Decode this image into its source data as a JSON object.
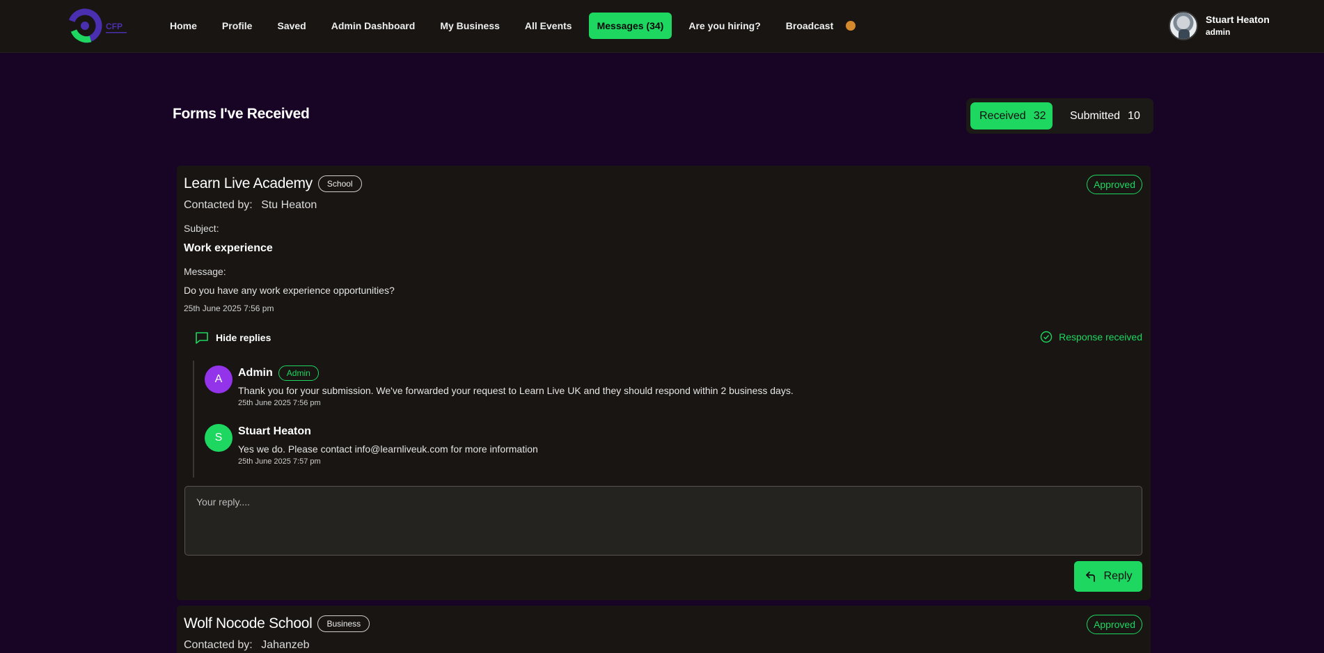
{
  "nav": {
    "logo_text": "CFP",
    "links": [
      {
        "label": "Home"
      },
      {
        "label": "Profile"
      },
      {
        "label": "Saved"
      },
      {
        "label": "Admin Dashboard"
      },
      {
        "label": "My Business"
      },
      {
        "label": "All Events"
      },
      {
        "label": "Messages (34)",
        "active": true
      },
      {
        "label": "Are you hiring?"
      },
      {
        "label": "Broadcast"
      }
    ],
    "user": {
      "name": "Stuart Heaton",
      "role": "admin"
    }
  },
  "header": {
    "title": "Forms I've Received",
    "toggle": {
      "received_label": "Received",
      "received_count": "32",
      "submitted_label": "Submitted",
      "submitted_count": "10"
    }
  },
  "forms": [
    {
      "org": "Learn Live Academy",
      "tag": "School",
      "status": "Approved",
      "contacted_label": "Contacted by:",
      "contact": "Stu Heaton",
      "subject_label": "Subject:",
      "subject": "Work experience",
      "message_label": "Message:",
      "message": "Do you have any work experience opportunities?",
      "date": "25th June 2025 7:56 pm",
      "replies_toggle": "Hide replies",
      "response_status": "Response received",
      "replies": [
        {
          "initial": "A",
          "name": "Admin",
          "badge": "Admin",
          "text": "Thank you for your submission. We've forwarded your request to Learn Live UK and they should respond within 2 business days.",
          "date": "25th June 2025 7:56 pm"
        },
        {
          "initial": "S",
          "name": "Stuart Heaton",
          "text": "Yes we do. Please contact info@learnliveuk.com for more information",
          "date": "25th June 2025 7:57 pm"
        }
      ],
      "reply_placeholder": "Your reply....",
      "reply_button": "Reply"
    },
    {
      "org": "Wolf Nocode School",
      "tag": "Business",
      "status": "Approved",
      "contacted_label": "Contacted by:",
      "contact": "Jahanzeb"
    }
  ],
  "colors": {
    "accent": "#1ed760",
    "background": "#180526",
    "card": "#181512",
    "admin_avatar": "#9333ea",
    "broadcast_dot": "#d48a2c"
  }
}
